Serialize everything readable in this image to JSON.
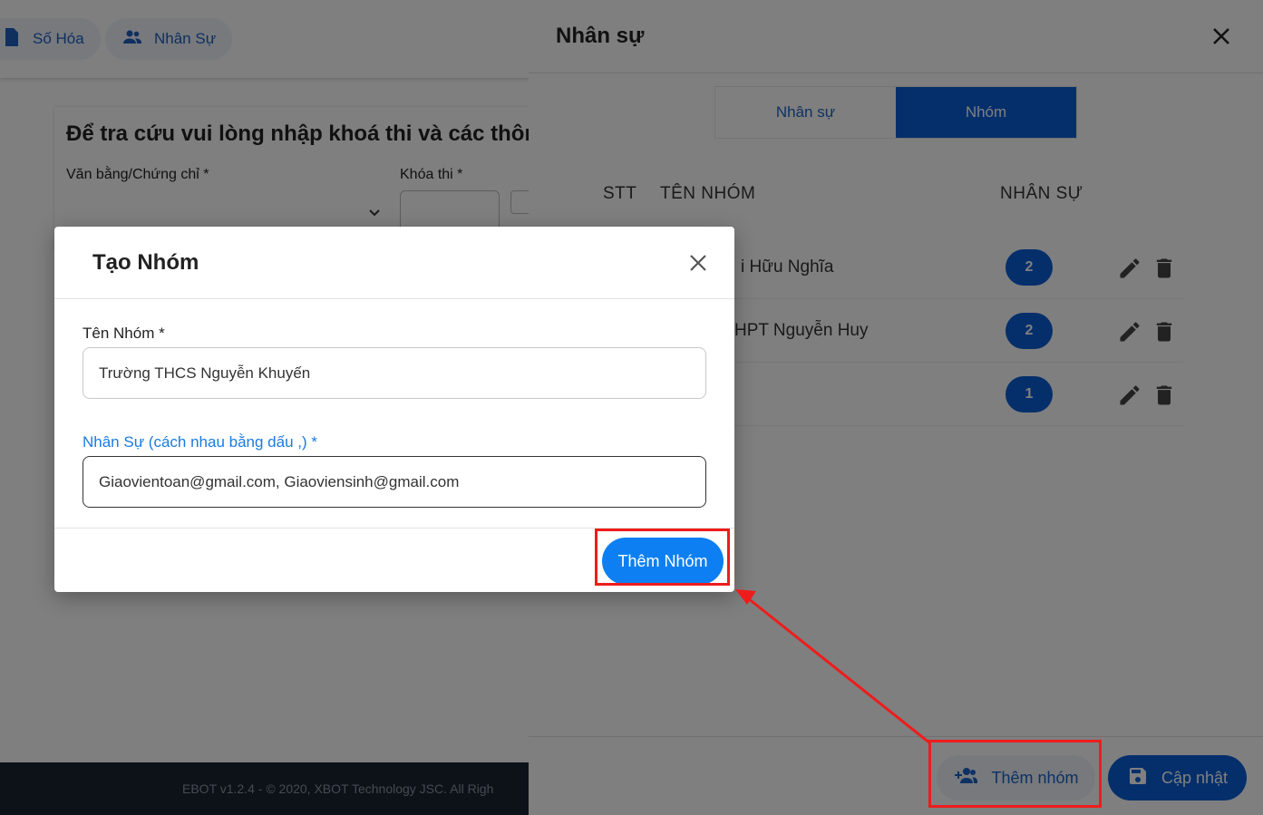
{
  "background": {
    "nav": [
      {
        "label": "Số Hóa",
        "icon": "document-icon"
      },
      {
        "label": "Nhân Sự",
        "icon": "people-icon"
      }
    ],
    "search_title": "Để tra cứu vui lòng nhập khoá thi và các thôn",
    "fields": {
      "certificate_label": "Văn bằng/Chứng chỉ *",
      "exam_label": "Khóa thi *"
    },
    "footer": "EBOT v1.2.4 - © 2020, XBOT Technology JSC. All Righ"
  },
  "drawer": {
    "title": "Nhân sự",
    "tabs": [
      {
        "label": "Nhân sự",
        "active": false
      },
      {
        "label": "Nhóm",
        "active": true
      }
    ],
    "columns": {
      "stt": "STT",
      "name": "TÊN NHÓM",
      "members": "NHÂN SỰ"
    },
    "rows": [
      {
        "name": "i Hữu Nghĩa",
        "count": "2"
      },
      {
        "name": "HPT Nguyễn Huy",
        "count": "2"
      },
      {
        "name": "",
        "count": "1"
      }
    ],
    "add_group_label": "Thêm nhóm",
    "update_label": "Cập nhật"
  },
  "modal": {
    "title": "Tạo Nhóm",
    "name_label": "Tên Nhóm *",
    "name_value": "Trường THCS Nguyễn Khuyến",
    "members_label": "Nhân Sự (cách nhau bằng dấu ,) *",
    "members_value": "Giaovientoan@gmail.com, Giaoviensinh@gmail.com",
    "submit_label": "Thêm Nhóm"
  },
  "colors": {
    "primary": "#0a5fd6",
    "submit": "#0d7ff2",
    "annotation": "#ee1c1c",
    "focus_label": "#1a7be0"
  }
}
